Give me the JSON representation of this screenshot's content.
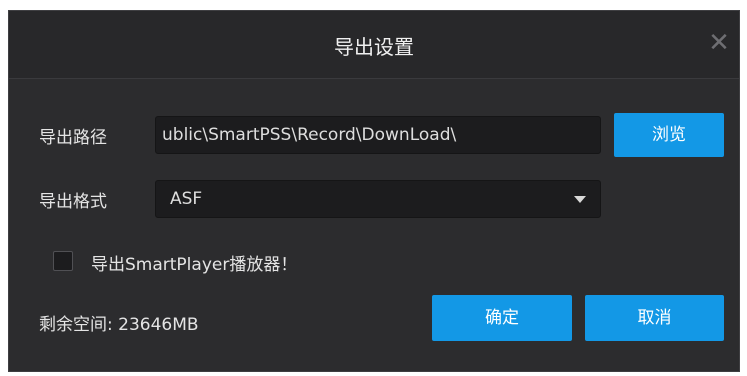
{
  "dialog": {
    "title": "导出设置",
    "close_symbol": "✕"
  },
  "path": {
    "label": "导出路径",
    "value": "C:\\Users\\Public\\SmartPSS\\Record\\DownLoad\\",
    "visible_value": "ublic\\SmartPSS\\Record\\DownLoad\\",
    "browse_label": "浏览"
  },
  "format": {
    "label": "导出格式",
    "selected": "ASF"
  },
  "export_player": {
    "label": "导出SmartPlayer播放器！",
    "checked": false
  },
  "space": {
    "text": "剩余空间: 23646MB"
  },
  "actions": {
    "ok_label": "确定",
    "cancel_label": "取消"
  },
  "colors": {
    "accent": "#1398e6",
    "dialog_bg": "#2c2c2e",
    "input_bg": "#1c1c1e"
  }
}
